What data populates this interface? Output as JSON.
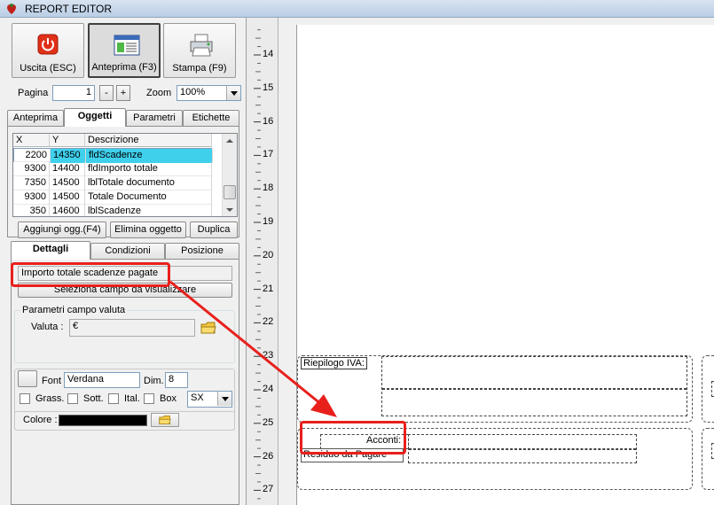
{
  "window": {
    "title": "REPORT EDITOR"
  },
  "toolbar": {
    "exit_label": "Uscita (ESC)",
    "preview_label": "Anteprima (F3)",
    "print_label": "Stampa (F9)"
  },
  "nav": {
    "page_label": "Pagina",
    "page_value": "1",
    "minus_label": "-",
    "plus_label": "+",
    "zoom_label": "Zoom",
    "zoom_value": "100%"
  },
  "tabs_top": [
    {
      "label": "Anteprima"
    },
    {
      "label": "Oggetti"
    },
    {
      "label": "Parametri"
    },
    {
      "label": "Etichette"
    }
  ],
  "grid": {
    "headers": [
      "X",
      "Y",
      "Descrizione"
    ],
    "rows": [
      {
        "x": "2200",
        "y": "14350",
        "desc": "fldScadenze"
      },
      {
        "x": "9300",
        "y": "14400",
        "desc": "fldImporto totale"
      },
      {
        "x": "7350",
        "y": "14500",
        "desc": "lblTotale documento"
      },
      {
        "x": "9300",
        "y": "14500",
        "desc": "Totale Documento"
      },
      {
        "x": "350",
        "y": "14600",
        "desc": "lblScadenze"
      }
    ]
  },
  "obj_buttons": {
    "add": "Aggiungi ogg.(F4)",
    "delete": "Elimina oggetto",
    "duplicate": "Duplica"
  },
  "tabs_detail": [
    {
      "label": "Dettagli"
    },
    {
      "label": "Condizioni"
    },
    {
      "label": "Posizione"
    }
  ],
  "detail": {
    "field_value": "Importo totale scadenze pagate",
    "select_field_label": "Seleziona campo da visualizzare"
  },
  "currency": {
    "group_title": "Parametri campo valuta",
    "valuta_label": "Valuta :",
    "valuta_value": "€"
  },
  "font": {
    "font_label": "Font",
    "font_value": "Verdana",
    "dim_label": "Dim.",
    "dim_value": "8",
    "grass_label": "Grass.",
    "sott_label": "Sott.",
    "ital_label": "Ital.",
    "box_label": "Box",
    "align_value": "SX",
    "color_label": "Colore :"
  },
  "ruler": {
    "marks": [
      "14",
      "15",
      "16",
      "17",
      "18",
      "19",
      "20",
      "21",
      "22",
      "23",
      "24",
      "25",
      "26",
      "27"
    ]
  },
  "canvas": {
    "riepilogo_label": "Riepilogo IVA:",
    "acconti_label": "Acconti:",
    "residuo_label": "Residuo da Pagare"
  },
  "colors": {
    "highlight_row": "#3fd0ec",
    "annotation": "#e8201c"
  }
}
